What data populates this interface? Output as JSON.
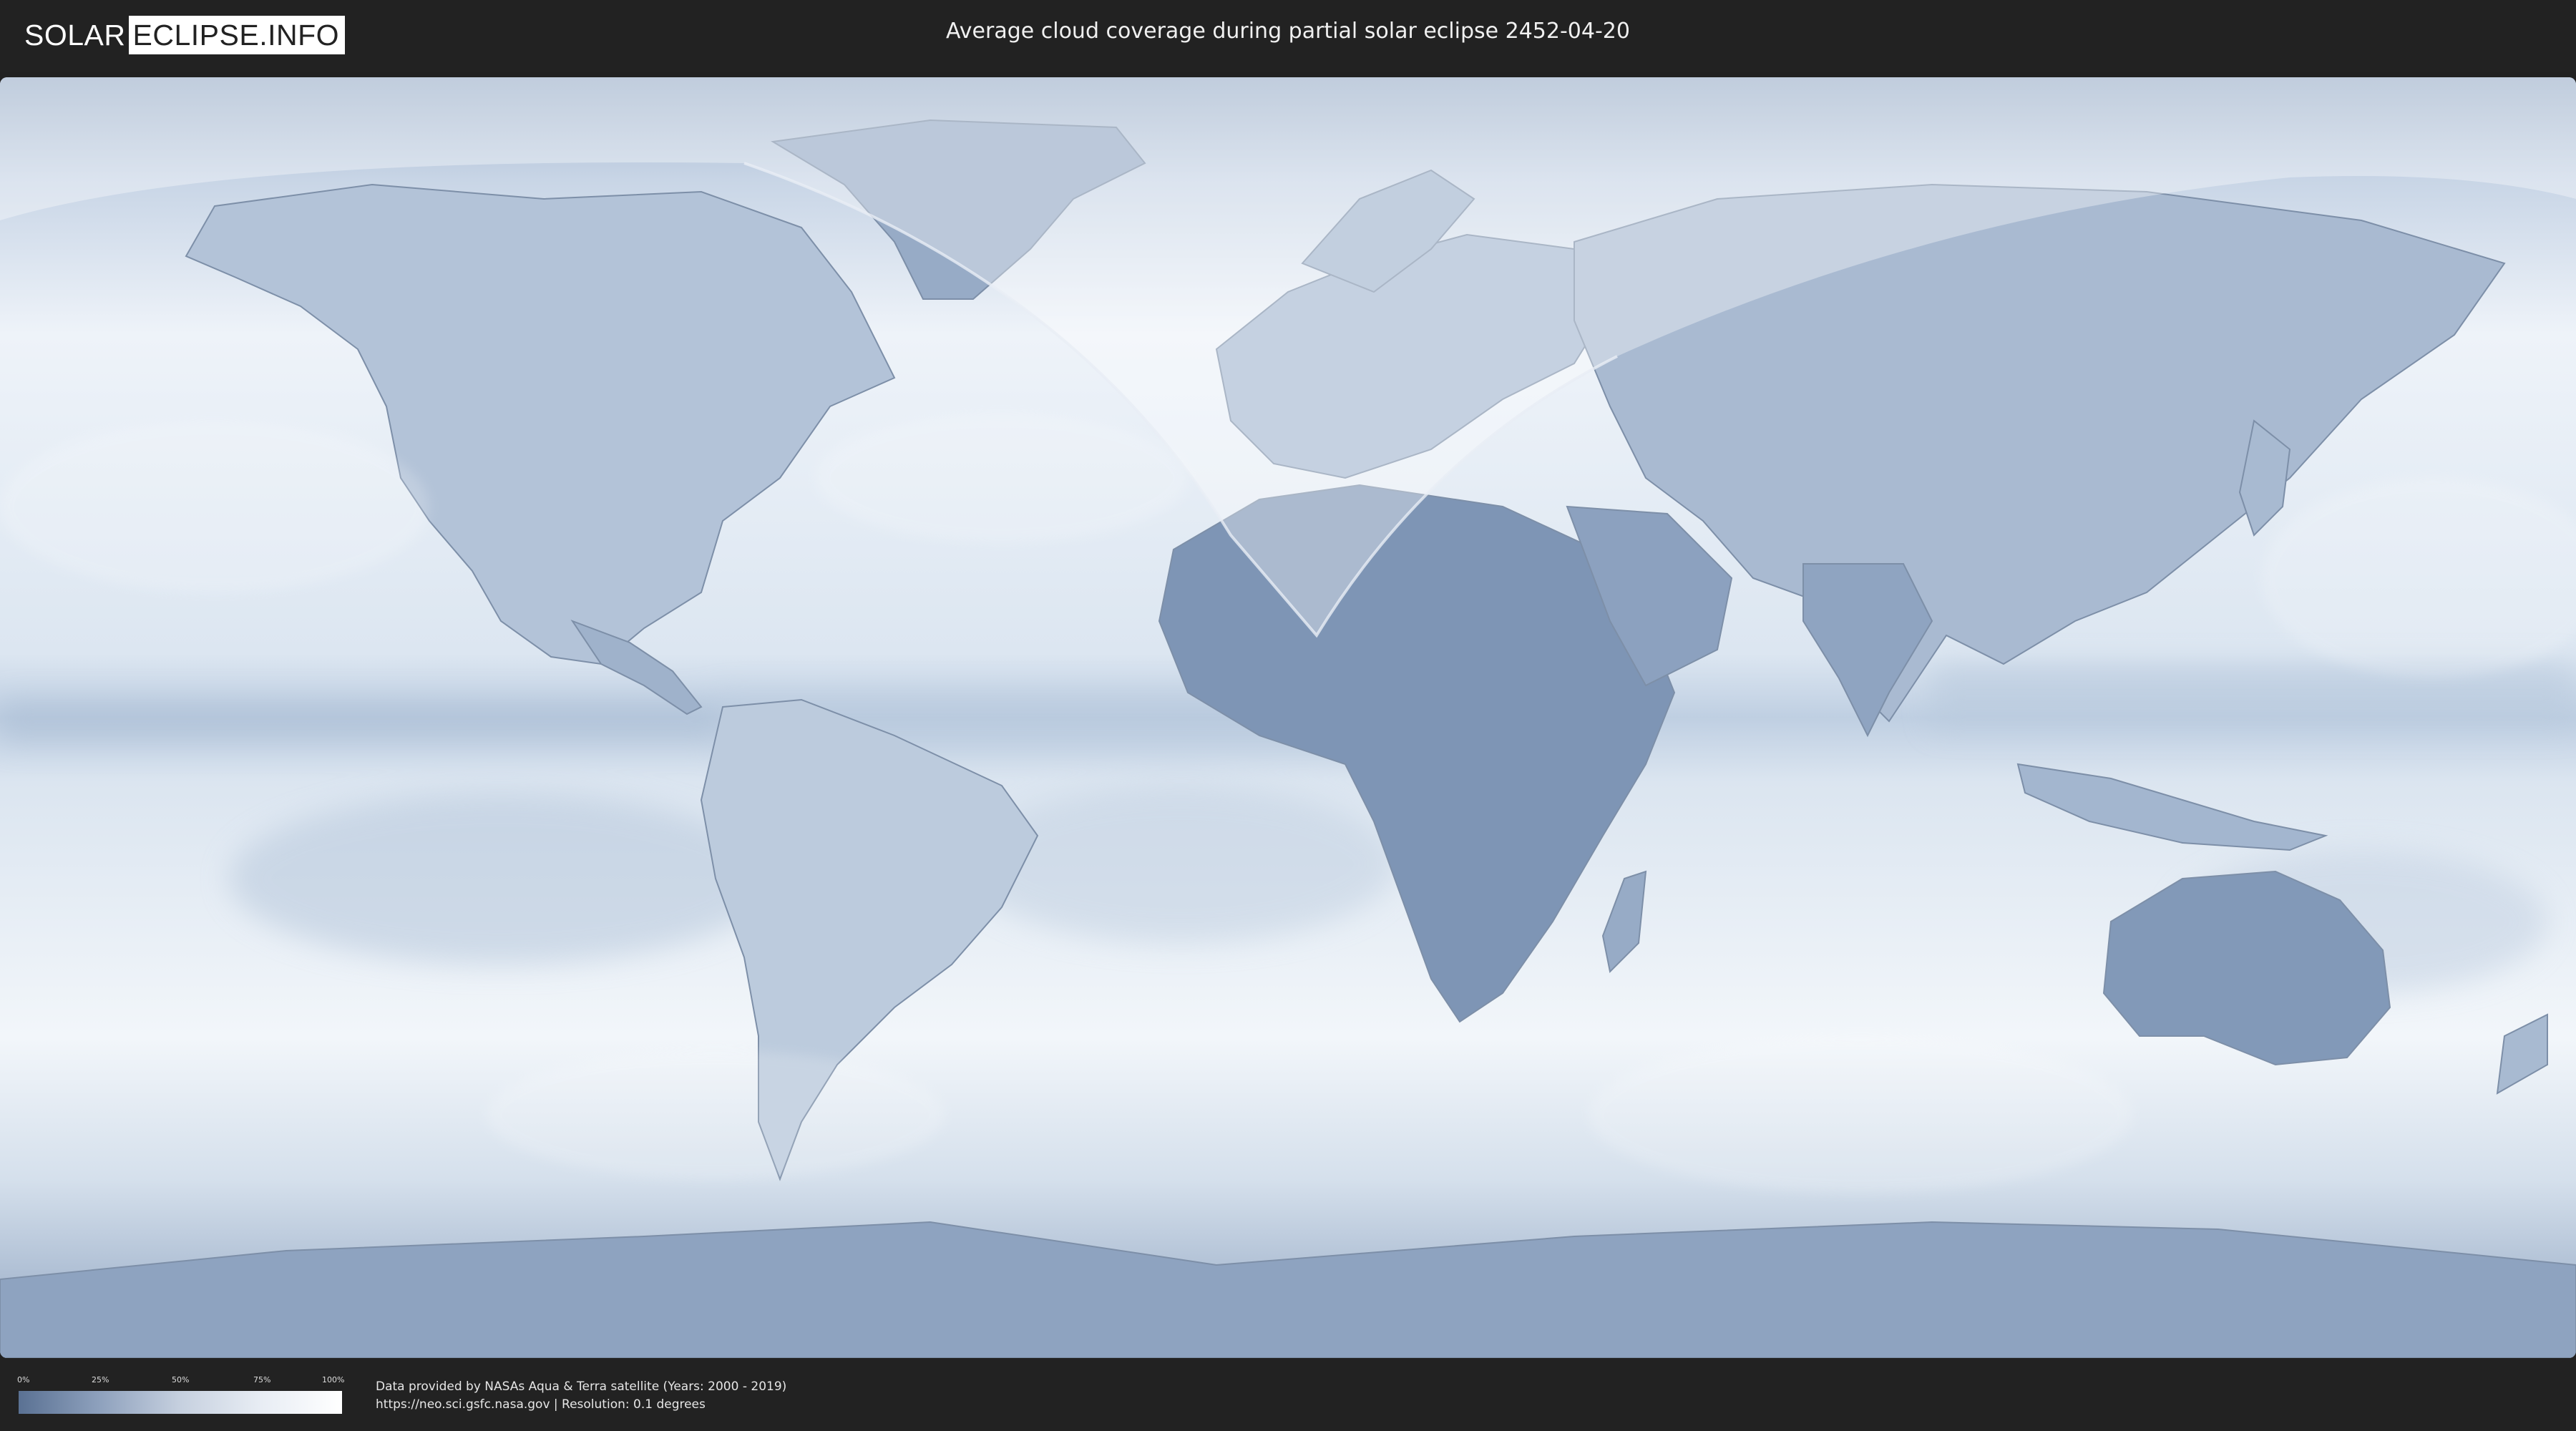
{
  "header": {
    "logo_left": "SOLAR",
    "logo_right": "ECLIPSE.INFO",
    "title": "Average cloud coverage during partial solar eclipse 2452-04-20"
  },
  "legend": {
    "ticks": [
      "0%",
      "25%",
      "50%",
      "75%",
      "100%"
    ],
    "colors": {
      "min": "#5a7193",
      "max": "#ffffff"
    }
  },
  "credits": {
    "line1": "Data provided by NASAs Aqua & Terra satellite (Years: 2000 - 2019)",
    "line2": "https://neo.sci.gsfc.nasa.gov | Resolution: 0.1 degrees"
  },
  "map": {
    "projection": "equirectangular world map",
    "colors": {
      "cloud_cover_high": "#f4f7fb",
      "cloud_cover_low": "#6f87aa",
      "eclipse_visibility_overlay": "#ffffff"
    }
  }
}
